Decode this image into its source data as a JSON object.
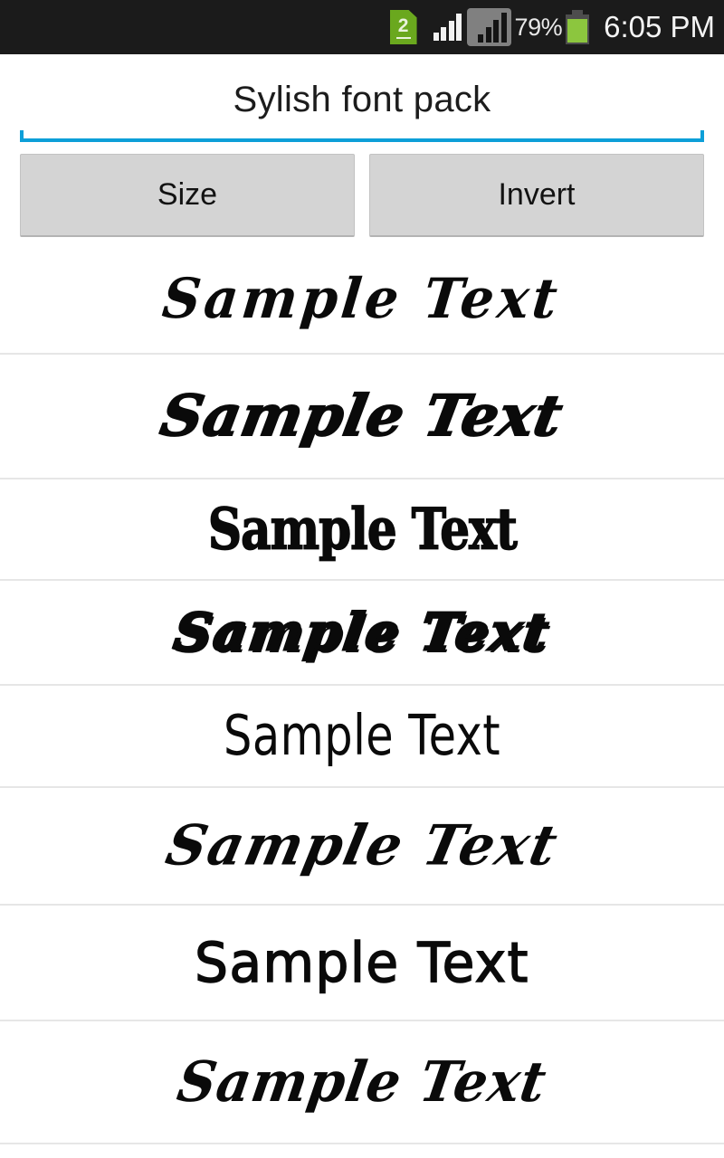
{
  "status_bar": {
    "sim_badge": "2",
    "sim_icon": "sim-card-2-icon",
    "signal_icon_1": "signal-bars-icon",
    "signal_icon_2": "signal-bars-boxed-icon",
    "battery_percent": "79%",
    "battery_icon": "battery-icon",
    "clock": "6:05 PM",
    "background_color": "#1b1b1b",
    "battery_fill_color": "#8cc63e",
    "sim_color": "#6aa81e"
  },
  "header": {
    "title": "Sylish font pack",
    "underline_color": "#0d9fd8"
  },
  "toolbar": {
    "size_label": "Size",
    "invert_label": "Invert",
    "button_color": "#d4d4d4"
  },
  "font_list": {
    "divider_color": "#e6e6e6",
    "rows": [
      {
        "sample": "Sample Text",
        "style": "bold-english-script"
      },
      {
        "sample": "Sample Text",
        "style": "heavy-decorative-script"
      },
      {
        "sample": "Sample Text",
        "style": "blackletter-gothic"
      },
      {
        "sample": "Sample Text",
        "style": "outlined-shadow-script"
      },
      {
        "sample": "Sample Text",
        "style": "thin-handwritten-marker"
      },
      {
        "sample": "Sample Text",
        "style": "flourished-calligraphy"
      },
      {
        "sample": "Sample Text",
        "style": "rounded-handwriting"
      },
      {
        "sample": "Sample Text",
        "style": "brush-script"
      }
    ]
  }
}
